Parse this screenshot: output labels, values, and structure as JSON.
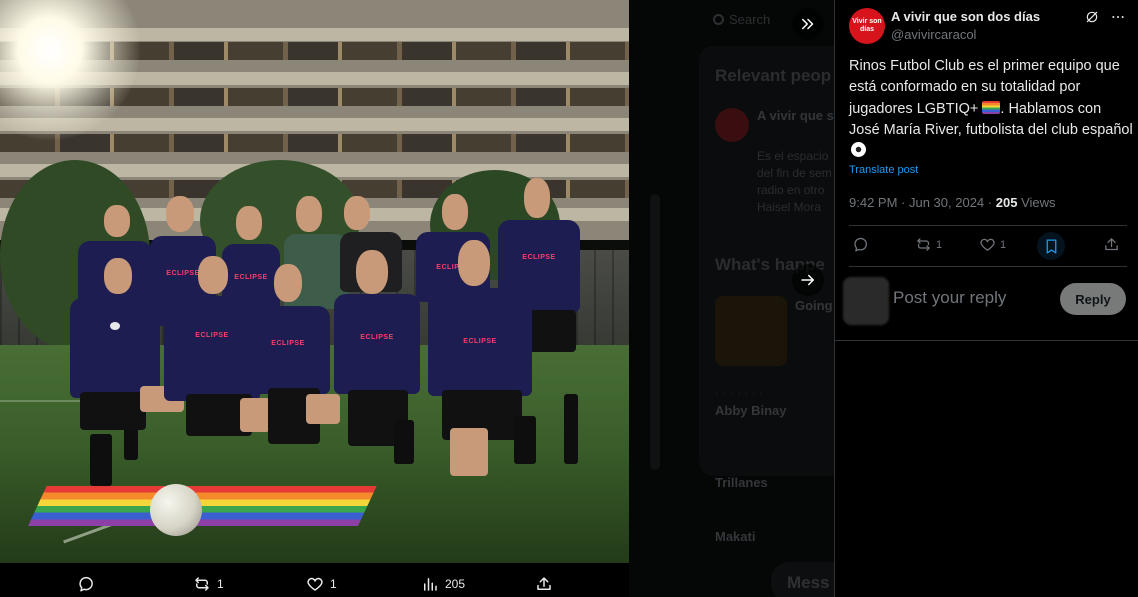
{
  "media_actions": {
    "reply": "",
    "reposts": "1",
    "likes": "1",
    "views": "205"
  },
  "background": {
    "search_placeholder": "Search",
    "relevant_heading": "Relevant peop",
    "relevant_name": "A vivir que s",
    "relevant_bio_1": "Es el espacio",
    "relevant_bio_2": "del fin de sem",
    "relevant_bio_3": "radio en otro",
    "relevant_bio_4": "Haisel Mora",
    "whats_happening": "What's happe",
    "trend_1_label": "Going",
    "trend_2_name": "Abby Binay",
    "trend_3_name": "Trillanes",
    "trend_4_name": "Makati",
    "messages": "Mess"
  },
  "post": {
    "author_name": "A vivir que son dos días",
    "author_handle": "@avivircaracol",
    "avatar_text": "Vivir son días",
    "text_part1": "Rinos Futbol Club es el primer equipo que está conformado en su totalidad por jugadores LGBTIQ+ ",
    "text_part2": ". Hablamos con José María River, futbolista del club español ",
    "translate": "Translate post",
    "time": "9:42 PM",
    "date": "Jun 30, 2024",
    "views_count": "205",
    "views_label": "Views",
    "reposts": "1",
    "likes": "1"
  },
  "reply": {
    "placeholder": "Post your reply",
    "button": "Reply"
  },
  "colors": {
    "accent": "#1d9bf0",
    "brand_red": "#d7141c",
    "muted": "#71767b"
  }
}
